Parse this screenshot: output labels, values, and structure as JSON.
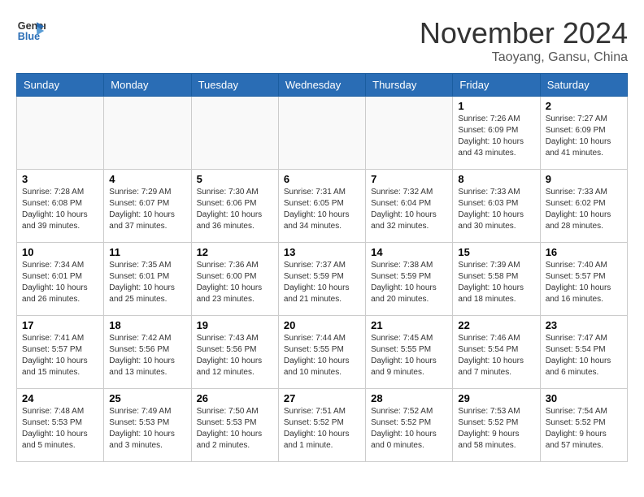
{
  "header": {
    "logo_line1": "General",
    "logo_line2": "Blue",
    "month_title": "November 2024",
    "location": "Taoyang, Gansu, China"
  },
  "weekdays": [
    "Sunday",
    "Monday",
    "Tuesday",
    "Wednesday",
    "Thursday",
    "Friday",
    "Saturday"
  ],
  "weeks": [
    [
      {
        "day": "",
        "info": ""
      },
      {
        "day": "",
        "info": ""
      },
      {
        "day": "",
        "info": ""
      },
      {
        "day": "",
        "info": ""
      },
      {
        "day": "",
        "info": ""
      },
      {
        "day": "1",
        "info": "Sunrise: 7:26 AM\nSunset: 6:09 PM\nDaylight: 10 hours and 43 minutes."
      },
      {
        "day": "2",
        "info": "Sunrise: 7:27 AM\nSunset: 6:09 PM\nDaylight: 10 hours and 41 minutes."
      }
    ],
    [
      {
        "day": "3",
        "info": "Sunrise: 7:28 AM\nSunset: 6:08 PM\nDaylight: 10 hours and 39 minutes."
      },
      {
        "day": "4",
        "info": "Sunrise: 7:29 AM\nSunset: 6:07 PM\nDaylight: 10 hours and 37 minutes."
      },
      {
        "day": "5",
        "info": "Sunrise: 7:30 AM\nSunset: 6:06 PM\nDaylight: 10 hours and 36 minutes."
      },
      {
        "day": "6",
        "info": "Sunrise: 7:31 AM\nSunset: 6:05 PM\nDaylight: 10 hours and 34 minutes."
      },
      {
        "day": "7",
        "info": "Sunrise: 7:32 AM\nSunset: 6:04 PM\nDaylight: 10 hours and 32 minutes."
      },
      {
        "day": "8",
        "info": "Sunrise: 7:33 AM\nSunset: 6:03 PM\nDaylight: 10 hours and 30 minutes."
      },
      {
        "day": "9",
        "info": "Sunrise: 7:33 AM\nSunset: 6:02 PM\nDaylight: 10 hours and 28 minutes."
      }
    ],
    [
      {
        "day": "10",
        "info": "Sunrise: 7:34 AM\nSunset: 6:01 PM\nDaylight: 10 hours and 26 minutes."
      },
      {
        "day": "11",
        "info": "Sunrise: 7:35 AM\nSunset: 6:01 PM\nDaylight: 10 hours and 25 minutes."
      },
      {
        "day": "12",
        "info": "Sunrise: 7:36 AM\nSunset: 6:00 PM\nDaylight: 10 hours and 23 minutes."
      },
      {
        "day": "13",
        "info": "Sunrise: 7:37 AM\nSunset: 5:59 PM\nDaylight: 10 hours and 21 minutes."
      },
      {
        "day": "14",
        "info": "Sunrise: 7:38 AM\nSunset: 5:59 PM\nDaylight: 10 hours and 20 minutes."
      },
      {
        "day": "15",
        "info": "Sunrise: 7:39 AM\nSunset: 5:58 PM\nDaylight: 10 hours and 18 minutes."
      },
      {
        "day": "16",
        "info": "Sunrise: 7:40 AM\nSunset: 5:57 PM\nDaylight: 10 hours and 16 minutes."
      }
    ],
    [
      {
        "day": "17",
        "info": "Sunrise: 7:41 AM\nSunset: 5:57 PM\nDaylight: 10 hours and 15 minutes."
      },
      {
        "day": "18",
        "info": "Sunrise: 7:42 AM\nSunset: 5:56 PM\nDaylight: 10 hours and 13 minutes."
      },
      {
        "day": "19",
        "info": "Sunrise: 7:43 AM\nSunset: 5:56 PM\nDaylight: 10 hours and 12 minutes."
      },
      {
        "day": "20",
        "info": "Sunrise: 7:44 AM\nSunset: 5:55 PM\nDaylight: 10 hours and 10 minutes."
      },
      {
        "day": "21",
        "info": "Sunrise: 7:45 AM\nSunset: 5:55 PM\nDaylight: 10 hours and 9 minutes."
      },
      {
        "day": "22",
        "info": "Sunrise: 7:46 AM\nSunset: 5:54 PM\nDaylight: 10 hours and 7 minutes."
      },
      {
        "day": "23",
        "info": "Sunrise: 7:47 AM\nSunset: 5:54 PM\nDaylight: 10 hours and 6 minutes."
      }
    ],
    [
      {
        "day": "24",
        "info": "Sunrise: 7:48 AM\nSunset: 5:53 PM\nDaylight: 10 hours and 5 minutes."
      },
      {
        "day": "25",
        "info": "Sunrise: 7:49 AM\nSunset: 5:53 PM\nDaylight: 10 hours and 3 minutes."
      },
      {
        "day": "26",
        "info": "Sunrise: 7:50 AM\nSunset: 5:53 PM\nDaylight: 10 hours and 2 minutes."
      },
      {
        "day": "27",
        "info": "Sunrise: 7:51 AM\nSunset: 5:52 PM\nDaylight: 10 hours and 1 minute."
      },
      {
        "day": "28",
        "info": "Sunrise: 7:52 AM\nSunset: 5:52 PM\nDaylight: 10 hours and 0 minutes."
      },
      {
        "day": "29",
        "info": "Sunrise: 7:53 AM\nSunset: 5:52 PM\nDaylight: 9 hours and 58 minutes."
      },
      {
        "day": "30",
        "info": "Sunrise: 7:54 AM\nSunset: 5:52 PM\nDaylight: 9 hours and 57 minutes."
      }
    ]
  ]
}
